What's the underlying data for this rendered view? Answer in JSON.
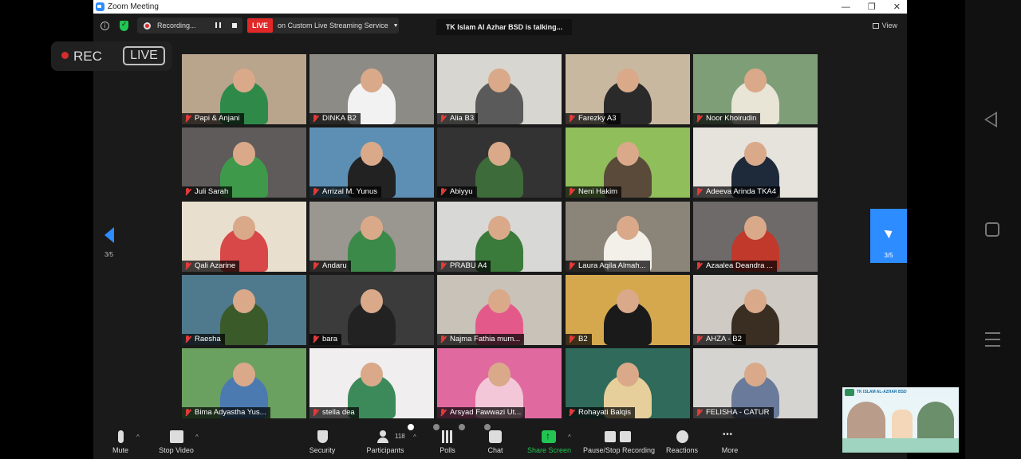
{
  "window": {
    "title": "Zoom Meeting"
  },
  "meeting_bar": {
    "recording_label": "Recording...",
    "live_badge": "LIVE",
    "live_service": "on Custom Live Streaming Service",
    "talking": "TK Islam Al Azhar BSD is talking...",
    "view_label": "View"
  },
  "overlay": {
    "rec": "REC",
    "live": "LIVE"
  },
  "pager": {
    "prev_page": "3/5",
    "next_page": "3/5"
  },
  "participants": [
    {
      "name": "Papi & Anjani",
      "bg": "#b9a48c",
      "shirt": "#2f8a4a"
    },
    {
      "name": "DINKA    B2",
      "bg": "#8d8b86",
      "shirt": "#f2f2f2"
    },
    {
      "name": "Alia B3",
      "bg": "#d8d6d0",
      "shirt": "#5a5a5a"
    },
    {
      "name": "Farezky A3",
      "bg": "#c9b8a0",
      "shirt": "#2a2a2a"
    },
    {
      "name": "Noor Khoirudin",
      "bg": "#7e9e78",
      "shirt": "#e8e4d6"
    },
    {
      "name": "Juli Sarah",
      "bg": "#5e5b5a",
      "shirt": "#3e9a4a"
    },
    {
      "name": "Arrizal M. Yunus",
      "bg": "#5d8fb4",
      "shirt": "#222222"
    },
    {
      "name": "Abiyyu",
      "bg": "#333333",
      "shirt": "#3d6b3a"
    },
    {
      "name": "Neni Hakim",
      "bg": "#8fbe5a",
      "shirt": "#5a4a3a"
    },
    {
      "name": "Adeeva Arinda TKA4",
      "bg": "#e6e2dc",
      "shirt": "#1e2a3a"
    },
    {
      "name": "Qali Azarine",
      "bg": "#e9dfcf",
      "shirt": "#d94848"
    },
    {
      "name": "Andaru",
      "bg": "#9a9690",
      "shirt": "#3c8a4a"
    },
    {
      "name": "PRABU A4",
      "bg": "#d8d8d6",
      "shirt": "#3a7a3a"
    },
    {
      "name": "Laura Aqila Almah...",
      "bg": "#8b8478",
      "shirt": "#f3f0ea"
    },
    {
      "name": "Azaalea Deandra ...",
      "bg": "#6e6a6a",
      "shirt": "#c0392b"
    },
    {
      "name": "Raesha",
      "bg": "#4f7a8e",
      "shirt": "#3a5a2a"
    },
    {
      "name": "bara",
      "bg": "#3b3b3b",
      "shirt": "#222222"
    },
    {
      "name": "Najma Fathia mum...",
      "bg": "#c9c2b8",
      "shirt": "#e35a8a"
    },
    {
      "name": "B2",
      "bg": "#d6a84e",
      "shirt": "#1a1a1a"
    },
    {
      "name": "AHZA - B2",
      "bg": "#cfcac4",
      "shirt": "#3a2e22"
    },
    {
      "name": "Bima Adyastha Yus...",
      "bg": "#6aa060",
      "shirt": "#4a7ab0"
    },
    {
      "name": "stella dea",
      "bg": "#f0eeee",
      "shirt": "#3c8a5a"
    },
    {
      "name": "Arsyad Fawwazi Ut...",
      "bg": "#e06aa0",
      "shirt": "#f3c7d7"
    },
    {
      "name": "Rohayati Balqis",
      "bg": "#2f6a5a",
      "shirt": "#e6cf9a"
    },
    {
      "name": "FELISHA - CATUR",
      "bg": "#d6d4d0",
      "shirt": "#6a7a9a"
    }
  ],
  "toolbar": {
    "mute": "Mute",
    "stop_video": "Stop Video",
    "security": "Security",
    "participants": "Participants",
    "participants_count": "118",
    "polls": "Polls",
    "chat": "Chat",
    "share_screen": "Share Screen",
    "pause_stop_recording": "Pause/Stop Recording",
    "reactions": "Reactions",
    "more": "More"
  },
  "pip": {
    "banner": "TK ISLAM AL-AZHAR BSD"
  },
  "colors": {
    "accent": "#2d8cff",
    "live_red": "#e02828",
    "share_green": "#23c552"
  }
}
